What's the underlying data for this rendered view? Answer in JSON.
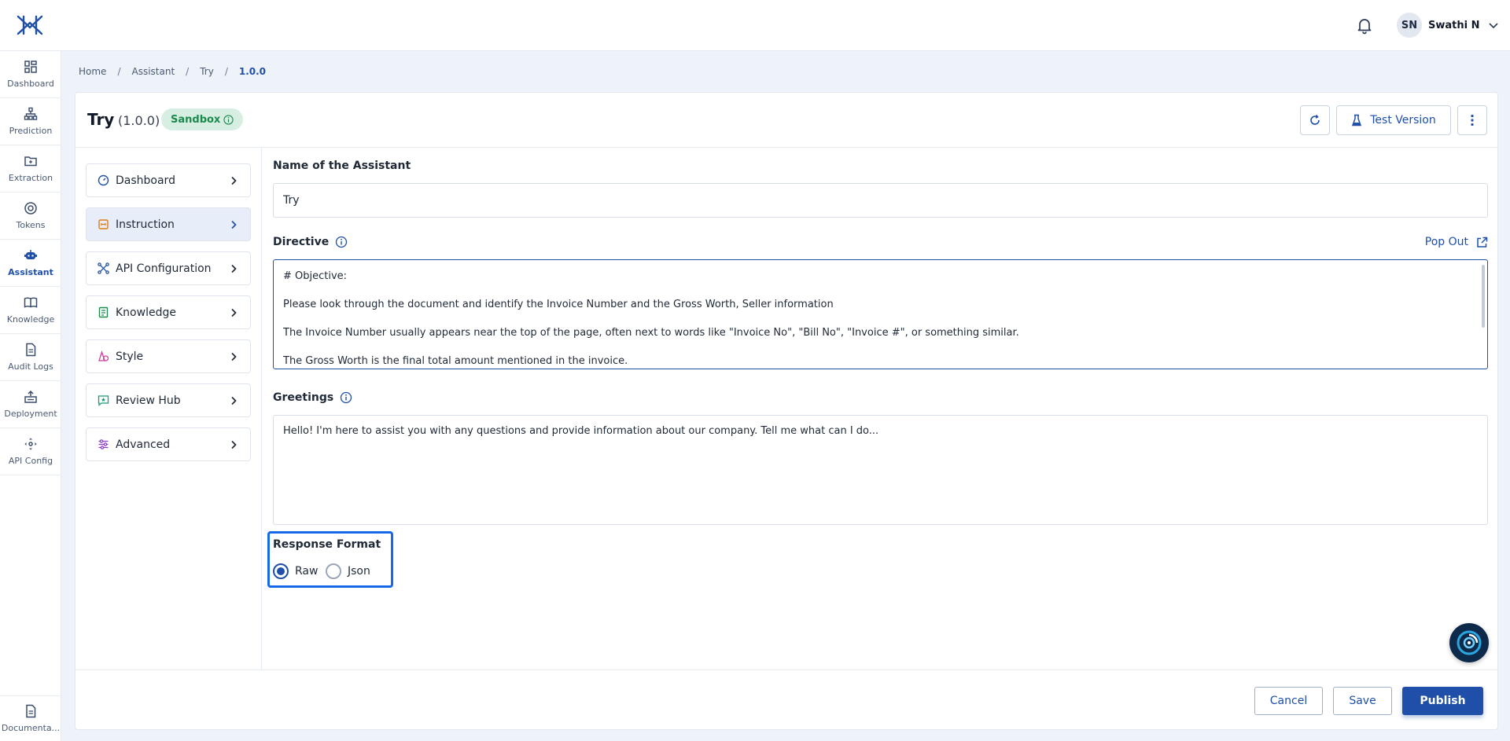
{
  "colors": {
    "primary": "#1f4fa8",
    "sandbox_bg": "#d7efe2",
    "sandbox_text": "#1b8a4c",
    "highlight_box": "#1769e8"
  },
  "topbar": {
    "logo_icon": "app-logo-icon",
    "notification_icon": "bell-icon",
    "avatar_initials": "SN",
    "username": "Swathi N",
    "user_menu_icon": "chevron-down-icon"
  },
  "rail": {
    "items": [
      {
        "label": "Dashboard",
        "icon": "dashboard-icon"
      },
      {
        "label": "Prediction",
        "icon": "hierarchy-icon"
      },
      {
        "label": "Extraction",
        "icon": "folder-icon"
      },
      {
        "label": "Tokens",
        "icon": "token-icon"
      },
      {
        "label": "Assistant",
        "icon": "robot-icon",
        "active": true
      },
      {
        "label": "Knowledge",
        "icon": "book-icon"
      },
      {
        "label": "Audit Logs",
        "icon": "document-icon"
      },
      {
        "label": "Deployment",
        "icon": "deploy-icon"
      },
      {
        "label": "API Config",
        "icon": "api-icon"
      }
    ],
    "footer": {
      "label": "Documenta...",
      "icon": "doc-icon"
    }
  },
  "breadcrumb": {
    "items": [
      "Home",
      "Assistant",
      "Try"
    ],
    "current": "1.0.0",
    "separator": "/"
  },
  "header": {
    "title": "Try",
    "version": "(1.0.0)",
    "badge": "Sandbox",
    "test_label": "Test Version"
  },
  "menu": {
    "items": [
      {
        "label": "Dashboard",
        "icon": "gauge-icon"
      },
      {
        "label": "Instruction",
        "icon": "instruction-icon",
        "active": true
      },
      {
        "label": "API Configuration",
        "icon": "network-icon"
      },
      {
        "label": "Knowledge",
        "icon": "knowledge-icon"
      },
      {
        "label": "Style",
        "icon": "style-icon"
      },
      {
        "label": "Review Hub",
        "icon": "review-icon"
      },
      {
        "label": "Advanced",
        "icon": "sliders-icon"
      }
    ]
  },
  "form": {
    "name_label": "Name of the Assistant",
    "name_value": "Try",
    "directive_label": "Directive",
    "popout_label": "Pop Out",
    "directive_lines": [
      "# Objective:",
      "Please look through the document and identify the Invoice Number and the Gross Worth, Seller information",
      "The Invoice Number usually appears near the top of the page, often next to words like \"Invoice No\", \"Bill No\", \"Invoice #\", or something similar.",
      "The Gross Worth is the final total amount mentioned in the invoice."
    ],
    "greetings_label": "Greetings",
    "greetings_value": "Hello! I'm here to assist you with any questions and provide information about our company. Tell me what can I do...",
    "response_format_label": "Response Format",
    "response_options": [
      {
        "label": "Raw",
        "selected": true
      },
      {
        "label": "Json",
        "selected": false
      }
    ]
  },
  "footer": {
    "cancel": "Cancel",
    "save": "Save",
    "publish": "Publish"
  }
}
